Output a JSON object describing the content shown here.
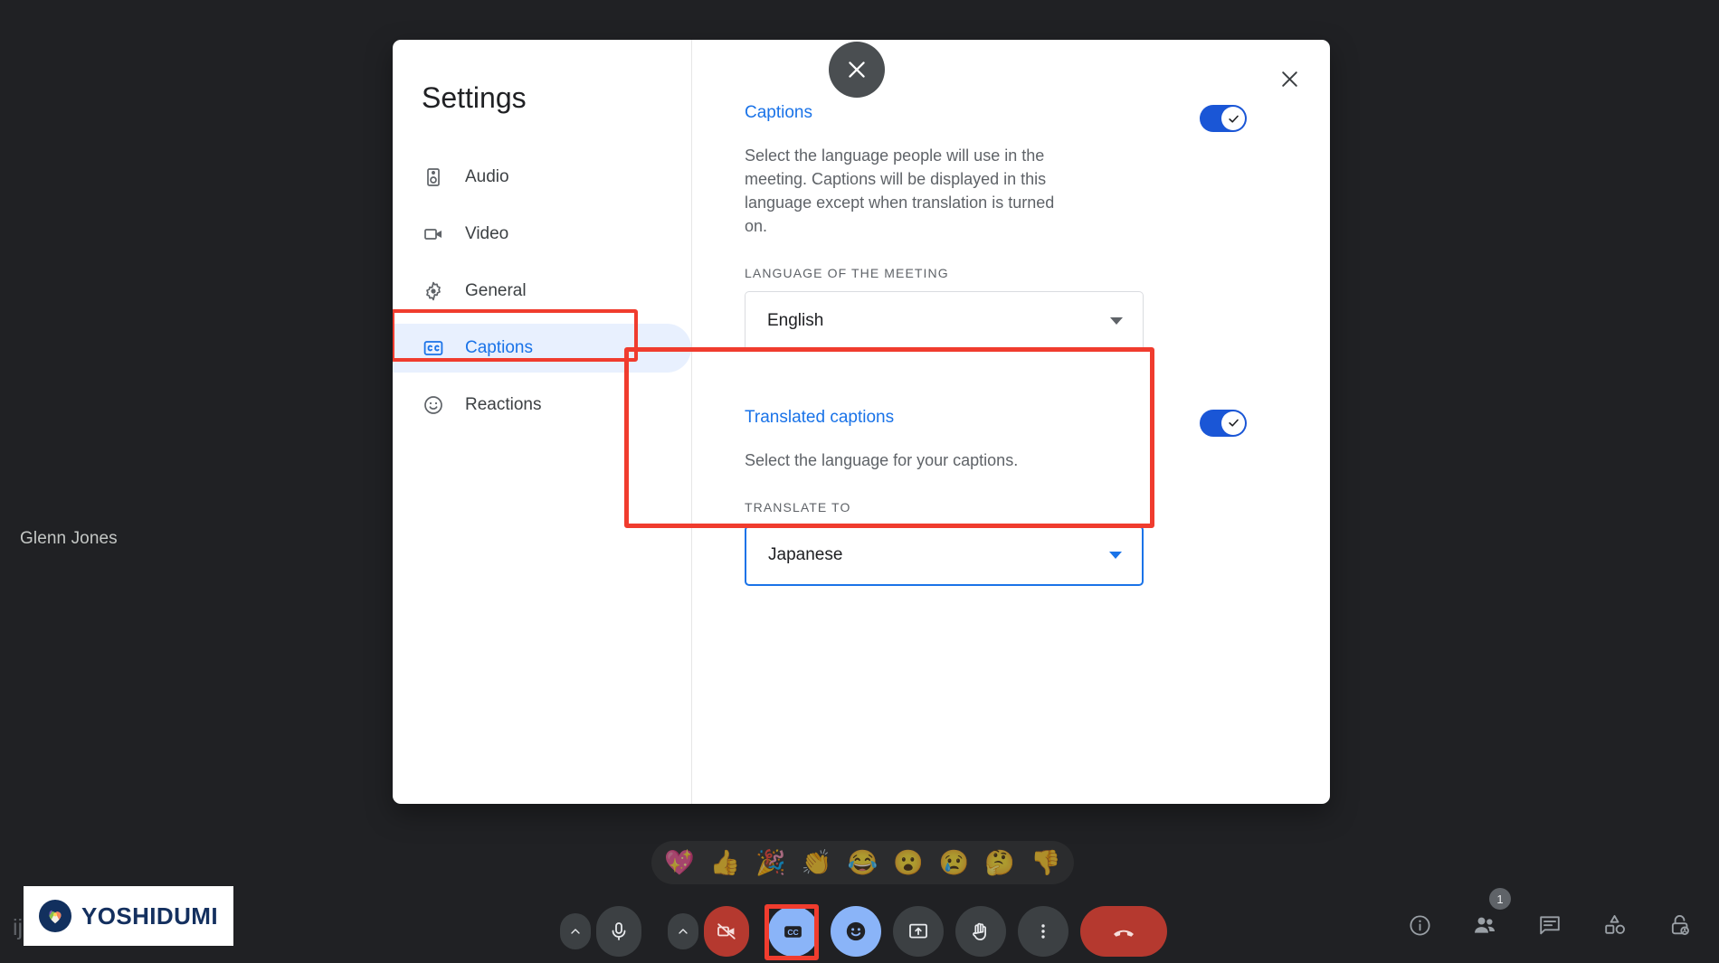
{
  "meeting": {
    "participant_name": "Glenn Jones",
    "background_text_fragment": "ij"
  },
  "brand": {
    "name": "YOSHIDUMI",
    "mark_icon": "heart-clover-icon",
    "mark_bg": "#12305e",
    "text_color": "#14305f"
  },
  "dialog": {
    "title": "Settings",
    "close_icon": "close-icon",
    "floating_close_icon": "close-icon",
    "nav": [
      {
        "label": "Audio",
        "icon": "speaker-icon",
        "active": false
      },
      {
        "label": "Video",
        "icon": "video-camera-icon",
        "active": false
      },
      {
        "label": "General",
        "icon": "gear-icon",
        "active": false
      },
      {
        "label": "Captions",
        "icon": "closed-caption-icon",
        "active": true
      },
      {
        "label": "Reactions",
        "icon": "smiley-icon",
        "active": false
      }
    ],
    "captions_section": {
      "title": "Captions",
      "description": "Select the language people will use in the meeting. Captions will be displayed in this language except when translation is turned on.",
      "toggle_on": true,
      "field_label": "LANGUAGE OF THE MEETING",
      "selected_language": "English",
      "caret_icon": "chevron-down-icon"
    },
    "translated_section": {
      "title": "Translated captions",
      "description": "Select the language for your captions.",
      "toggle_on": true,
      "field_label": "TRANSLATE TO",
      "selected_language": "Japanese",
      "caret_icon": "chevron-down-icon",
      "focused": true
    }
  },
  "reactions": {
    "emojis": [
      "💖",
      "👍",
      "🎉",
      "👏",
      "😂",
      "😮",
      "😢",
      "🤔",
      "👎"
    ]
  },
  "controls": [
    {
      "name": "microphone-button",
      "icon": "microphone-icon",
      "state": "on"
    },
    {
      "name": "camera-button",
      "icon": "camera-off-icon",
      "state": "off"
    },
    {
      "name": "captions-button",
      "icon": "closed-caption-icon",
      "state": "active"
    },
    {
      "name": "reactions-button",
      "icon": "smiley-icon",
      "state": "active"
    },
    {
      "name": "present-button",
      "icon": "present-screen-icon",
      "state": "default"
    },
    {
      "name": "raise-hand-button",
      "icon": "raised-hand-icon",
      "state": "default"
    },
    {
      "name": "more-options-button",
      "icon": "more-vertical-icon",
      "state": "default"
    },
    {
      "name": "end-call-button",
      "icon": "end-call-icon",
      "state": "danger"
    }
  ],
  "status_icons": [
    {
      "name": "meeting-details-button",
      "icon": "info-icon",
      "badge": ""
    },
    {
      "name": "participants-button",
      "icon": "people-icon",
      "badge": "1"
    },
    {
      "name": "chat-button",
      "icon": "chat-bubble-icon",
      "badge": ""
    },
    {
      "name": "activities-button",
      "icon": "shapes-icon",
      "badge": ""
    },
    {
      "name": "host-controls-button",
      "icon": "lock-person-icon",
      "badge": ""
    }
  ],
  "annotations": {
    "sidebar_highlight_color": "#f03c2e",
    "translated_highlight_color": "#f03c2e",
    "cc_button_highlight_color": "#f03c2e"
  }
}
